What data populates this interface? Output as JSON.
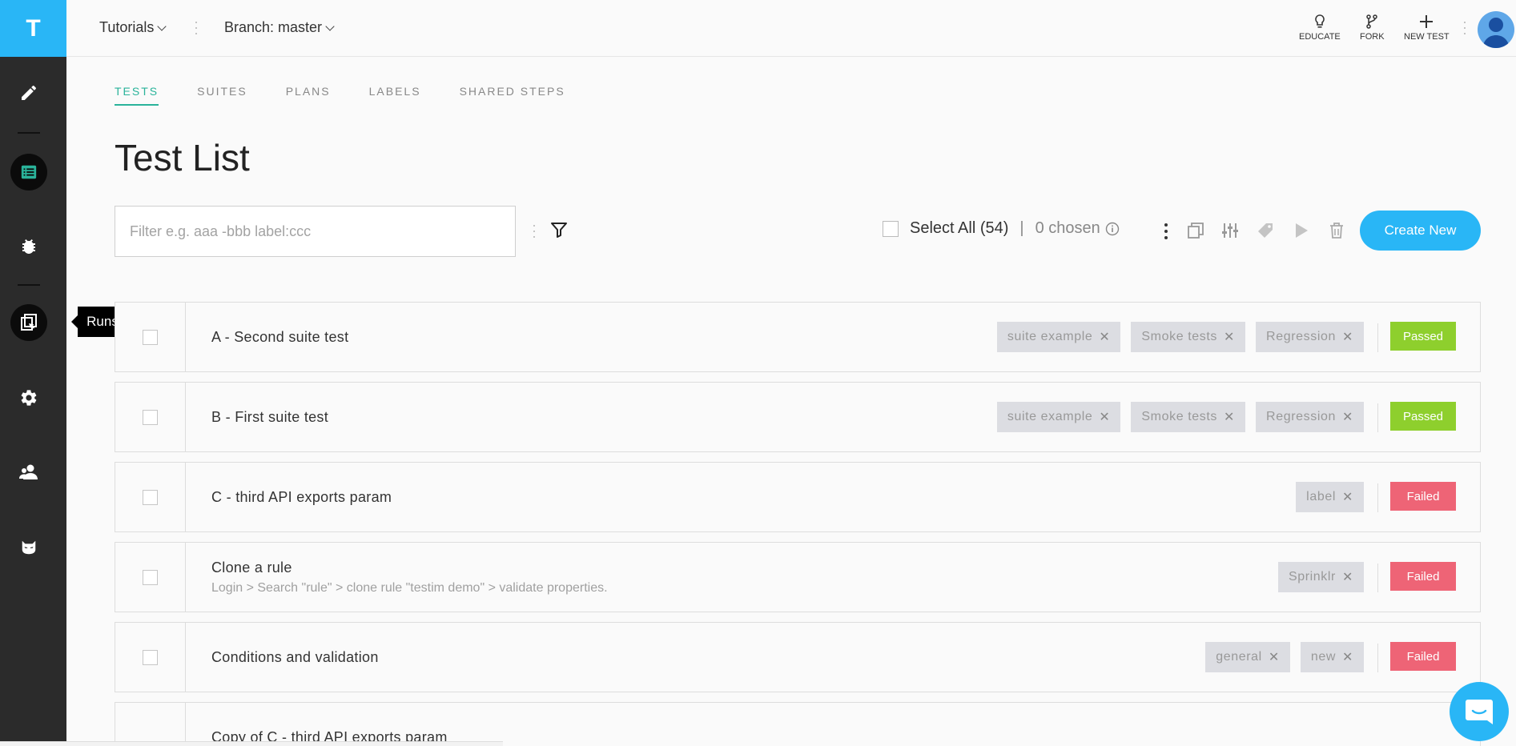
{
  "app": {
    "logo_letter": "T"
  },
  "topbar": {
    "project": "Tutorials",
    "branch": "Branch: master",
    "actions": [
      {
        "label": "EDUCATE",
        "icon": "lightbulb-icon"
      },
      {
        "label": "FORK",
        "icon": "fork-icon"
      },
      {
        "label": "NEW TEST",
        "icon": "plus-icon"
      }
    ]
  },
  "sidebar": {
    "items": [
      {
        "icon": "pencil-icon",
        "active": false
      },
      {
        "icon": "test-list-icon",
        "active": true,
        "accent": "#2ab39a"
      },
      {
        "icon": "bug-icon",
        "active": false
      },
      {
        "icon": "runs-icon",
        "active": true
      },
      {
        "icon": "gear-icon",
        "active": false
      },
      {
        "icon": "users-icon",
        "active": false
      },
      {
        "icon": "mask-icon",
        "active": false
      }
    ],
    "tooltip": "Runs"
  },
  "tabs": [
    "TESTS",
    "SUITES",
    "PLANS",
    "LABELS",
    "SHARED STEPS"
  ],
  "page_title": "Test List",
  "toolbar": {
    "filter_placeholder": "Filter e.g. aaa -bbb label:ccc",
    "select_all": "Select All (54)",
    "chosen": "0 chosen",
    "create_new": "Create New"
  },
  "tests": [
    {
      "title": "A - Second suite test",
      "description": "",
      "labels": [
        "suite example",
        "Smoke tests",
        "Regression"
      ],
      "status": "Passed"
    },
    {
      "title": "B - First suite test",
      "description": "",
      "labels": [
        "suite example",
        "Smoke tests",
        "Regression"
      ],
      "status": "Passed"
    },
    {
      "title": "C - third API exports param",
      "description": "",
      "labels": [
        "label"
      ],
      "status": "Failed"
    },
    {
      "title": "Clone a rule",
      "description": "Login > Search \"rule\" > clone rule \"testim demo\" > validate properties.",
      "labels": [
        "Sprinklr"
      ],
      "status": "Failed"
    },
    {
      "title": "Conditions and validation",
      "description": "",
      "labels": [
        "general",
        "new"
      ],
      "status": "Failed"
    },
    {
      "title": "Copy of C - third API exports param",
      "description": "",
      "labels": [],
      "status": ""
    }
  ],
  "colors": {
    "accent": "#29b6f6",
    "tab_active": "#2ab39a",
    "passed": "#8ecf2d",
    "failed": "#ee6476"
  }
}
